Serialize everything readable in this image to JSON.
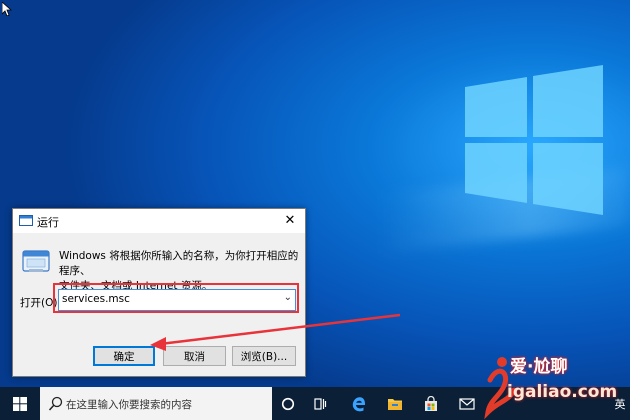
{
  "desktop": {},
  "run_dialog": {
    "title": "运行",
    "close_glyph": "✕",
    "description_line1": "Windows 将根据你所输入的名称，为你打开相应的程序、",
    "description_line2": "文件夹、文档或 Internet 资源。",
    "open_label": "打开(O):",
    "open_value": "services.msc",
    "ok_label": "确定",
    "cancel_label": "取消",
    "browse_label": "浏览(B)..."
  },
  "taskbar": {
    "search_placeholder": "在这里输入你要搜索的内容",
    "ime_label": "英",
    "icons": [
      "windows-start-icon",
      "search-icon",
      "cortana-circle-icon",
      "task-view-icon",
      "edge-icon",
      "file-explorer-icon",
      "store-icon",
      "mail-icon"
    ]
  },
  "watermark": {
    "line1": "爱·尬聊",
    "line2": "igaliao.com"
  },
  "colors": {
    "highlight": "#e8333a",
    "accent": "#0078d7",
    "taskbar": "#0b1f36"
  }
}
